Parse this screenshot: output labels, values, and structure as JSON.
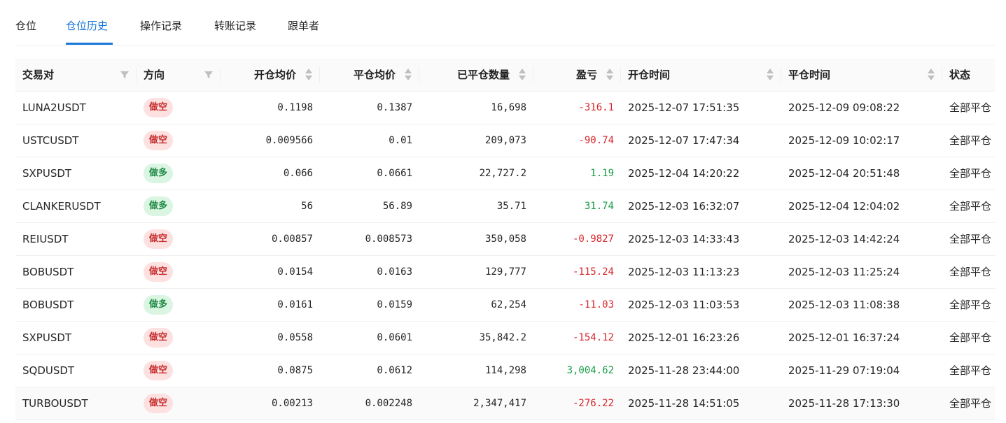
{
  "tabs": [
    {
      "label": "仓位"
    },
    {
      "label": "仓位历史",
      "active": true
    },
    {
      "label": "操作记录"
    },
    {
      "label": "转账记录"
    },
    {
      "label": "跟单者"
    }
  ],
  "columns": {
    "pair": "交易对",
    "side": "方向",
    "open_price": "开仓均价",
    "close_price": "平仓均价",
    "closed_qty": "已平仓数量",
    "pnl": "盈亏",
    "open_time": "开仓时间",
    "close_time": "平仓时间",
    "status": "状态"
  },
  "colors": {
    "accent": "#1677d9",
    "loss": "#d7262c",
    "profit": "#1a9d48",
    "short_bg": "#fde1e1",
    "long_bg": "#dbf5e3"
  },
  "rows": [
    {
      "pair": "LUNA2USDT",
      "side": "做空",
      "side_type": "short",
      "open_price": "0.1198",
      "close_price": "0.1387",
      "closed_qty": "16,698",
      "pnl": "-316.1",
      "pnl_type": "neg",
      "open_time": "2025-12-07 17:51:35",
      "close_time": "2025-12-09 09:08:22",
      "status": "全部平仓"
    },
    {
      "pair": "USTCUSDT",
      "side": "做空",
      "side_type": "short",
      "open_price": "0.009566",
      "close_price": "0.01",
      "closed_qty": "209,073",
      "pnl": "-90.74",
      "pnl_type": "neg",
      "open_time": "2025-12-07 17:47:34",
      "close_time": "2025-12-09 10:02:17",
      "status": "全部平仓"
    },
    {
      "pair": "SXPUSDT",
      "side": "做多",
      "side_type": "long",
      "open_price": "0.066",
      "close_price": "0.0661",
      "closed_qty": "22,727.2",
      "pnl": "1.19",
      "pnl_type": "pos",
      "open_time": "2025-12-04 14:20:22",
      "close_time": "2025-12-04 20:51:48",
      "status": "全部平仓"
    },
    {
      "pair": "CLANKERUSDT",
      "side": "做多",
      "side_type": "long",
      "open_price": "56",
      "close_price": "56.89",
      "closed_qty": "35.71",
      "pnl": "31.74",
      "pnl_type": "pos",
      "open_time": "2025-12-03 16:32:07",
      "close_time": "2025-12-04 12:04:02",
      "status": "全部平仓"
    },
    {
      "pair": "REIUSDT",
      "side": "做空",
      "side_type": "short",
      "open_price": "0.00857",
      "close_price": "0.008573",
      "closed_qty": "350,058",
      "pnl": "-0.9827",
      "pnl_type": "neg",
      "open_time": "2025-12-03 14:33:43",
      "close_time": "2025-12-03 14:42:24",
      "status": "全部平仓"
    },
    {
      "pair": "BOBUSDT",
      "side": "做空",
      "side_type": "short",
      "open_price": "0.0154",
      "close_price": "0.0163",
      "closed_qty": "129,777",
      "pnl": "-115.24",
      "pnl_type": "neg",
      "open_time": "2025-12-03 11:13:23",
      "close_time": "2025-12-03 11:25:24",
      "status": "全部平仓"
    },
    {
      "pair": "BOBUSDT",
      "side": "做多",
      "side_type": "long",
      "open_price": "0.0161",
      "close_price": "0.0159",
      "closed_qty": "62,254",
      "pnl": "-11.03",
      "pnl_type": "neg",
      "open_time": "2025-12-03 11:03:53",
      "close_time": "2025-12-03 11:08:38",
      "status": "全部平仓"
    },
    {
      "pair": "SXPUSDT",
      "side": "做空",
      "side_type": "short",
      "open_price": "0.0558",
      "close_price": "0.0601",
      "closed_qty": "35,842.2",
      "pnl": "-154.12",
      "pnl_type": "neg",
      "open_time": "2025-12-01 16:23:26",
      "close_time": "2025-12-01 16:37:24",
      "status": "全部平仓"
    },
    {
      "pair": "SQDUSDT",
      "side": "做空",
      "side_type": "short",
      "open_price": "0.0875",
      "close_price": "0.0612",
      "closed_qty": "114,298",
      "pnl": "3,004.62",
      "pnl_type": "pos",
      "open_time": "2025-11-28 23:44:00",
      "close_time": "2025-11-29 07:19:04",
      "status": "全部平仓"
    },
    {
      "pair": "TURBOUSDT",
      "side": "做空",
      "side_type": "short",
      "open_price": "0.00213",
      "close_price": "0.002248",
      "closed_qty": "2,347,417",
      "pnl": "-276.22",
      "pnl_type": "neg",
      "open_time": "2025-11-28 14:51:05",
      "close_time": "2025-11-28 17:13:30",
      "status": "全部平仓"
    }
  ]
}
